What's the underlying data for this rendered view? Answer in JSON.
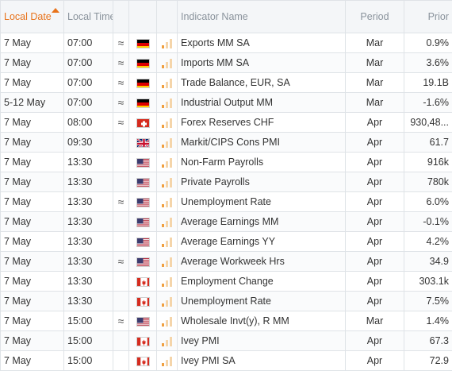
{
  "header": {
    "date": "Local Date",
    "time": "Local Time",
    "indicator": "Indicator Name",
    "period": "Period",
    "prior": "Prior"
  },
  "rows": [
    {
      "date": "7 May",
      "time": "07:00",
      "vol": "≈",
      "country": "DE",
      "importance": 1,
      "name": "Exports MM SA",
      "period": "Mar",
      "prior": "0.9%"
    },
    {
      "date": "7 May",
      "time": "07:00",
      "vol": "≈",
      "country": "DE",
      "importance": 1,
      "name": "Imports MM SA",
      "period": "Mar",
      "prior": "3.6%"
    },
    {
      "date": "7 May",
      "time": "07:00",
      "vol": "≈",
      "country": "DE",
      "importance": 1,
      "name": "Trade Balance, EUR, SA",
      "period": "Mar",
      "prior": "19.1B"
    },
    {
      "date": "5-12 May",
      "time": "07:00",
      "vol": "≈",
      "country": "DE",
      "importance": 1,
      "name": "Industrial Output MM",
      "period": "Mar",
      "prior": "-1.6%"
    },
    {
      "date": "7 May",
      "time": "08:00",
      "vol": "≈",
      "country": "CH",
      "importance": 1,
      "name": "Forex Reserves CHF",
      "period": "Apr",
      "prior": "930,48..."
    },
    {
      "date": "7 May",
      "time": "09:30",
      "vol": "",
      "country": "GB",
      "importance": 1,
      "name": "Markit/CIPS Cons PMI",
      "period": "Apr",
      "prior": "61.7"
    },
    {
      "date": "7 May",
      "time": "13:30",
      "vol": "",
      "country": "US",
      "importance": 1,
      "name": "Non-Farm Payrolls",
      "period": "Apr",
      "prior": "916k"
    },
    {
      "date": "7 May",
      "time": "13:30",
      "vol": "",
      "country": "US",
      "importance": 1,
      "name": "Private Payrolls",
      "period": "Apr",
      "prior": "780k"
    },
    {
      "date": "7 May",
      "time": "13:30",
      "vol": "≈",
      "country": "US",
      "importance": 1,
      "name": "Unemployment Rate",
      "period": "Apr",
      "prior": "6.0%"
    },
    {
      "date": "7 May",
      "time": "13:30",
      "vol": "",
      "country": "US",
      "importance": 1,
      "name": "Average Earnings MM",
      "period": "Apr",
      "prior": "-0.1%"
    },
    {
      "date": "7 May",
      "time": "13:30",
      "vol": "",
      "country": "US",
      "importance": 1,
      "name": "Average Earnings YY",
      "period": "Apr",
      "prior": "4.2%"
    },
    {
      "date": "7 May",
      "time": "13:30",
      "vol": "≈",
      "country": "US",
      "importance": 1,
      "name": "Average Workweek Hrs",
      "period": "Apr",
      "prior": "34.9"
    },
    {
      "date": "7 May",
      "time": "13:30",
      "vol": "",
      "country": "CA",
      "importance": 1,
      "name": "Employment Change",
      "period": "Apr",
      "prior": "303.1k"
    },
    {
      "date": "7 May",
      "time": "13:30",
      "vol": "",
      "country": "CA",
      "importance": 1,
      "name": "Unemployment Rate",
      "period": "Apr",
      "prior": "7.5%"
    },
    {
      "date": "7 May",
      "time": "15:00",
      "vol": "≈",
      "country": "US",
      "importance": 1,
      "name": "Wholesale Invt(y), R MM",
      "period": "Mar",
      "prior": "1.4%"
    },
    {
      "date": "7 May",
      "time": "15:00",
      "vol": "",
      "country": "CA",
      "importance": 1,
      "name": "Ivey PMI",
      "period": "Apr",
      "prior": "67.3"
    },
    {
      "date": "7 May",
      "time": "15:00",
      "vol": "",
      "country": "CA",
      "importance": 1,
      "name": "Ivey PMI SA",
      "period": "Apr",
      "prior": "72.9"
    }
  ],
  "colors": {
    "accent": "#e8731b",
    "bar_on": "#f0a040",
    "bar_off": "#f5d5aa",
    "header_bg": "#f4f6f8",
    "grid": "#dfe3e7"
  }
}
